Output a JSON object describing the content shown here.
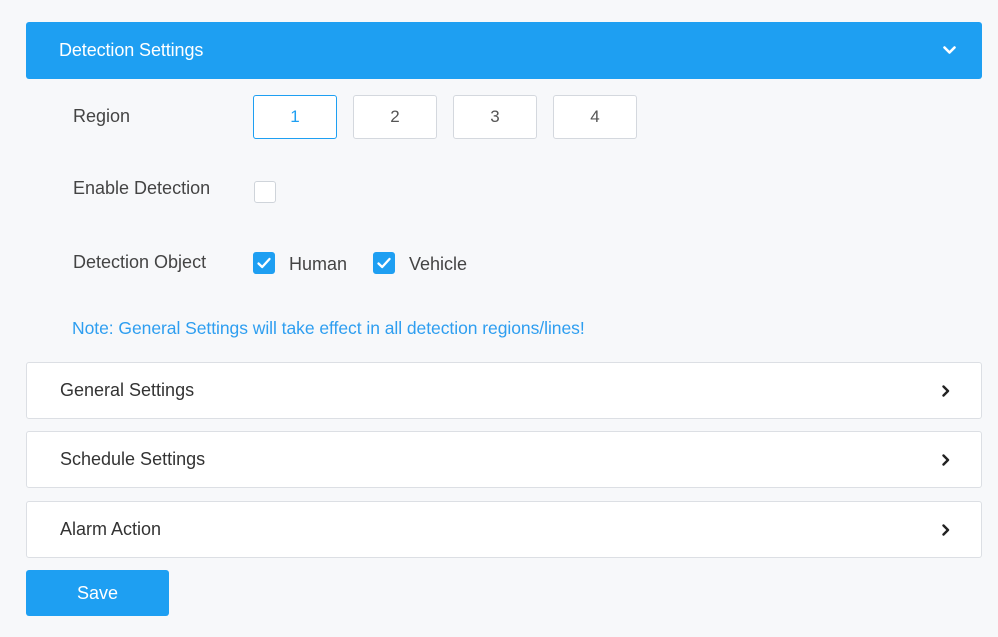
{
  "detection_settings": {
    "title": "Detection Settings",
    "expanded": true,
    "region": {
      "label": "Region",
      "options": [
        "1",
        "2",
        "3",
        "4"
      ],
      "selected": "1"
    },
    "enable_detection": {
      "label": "Enable Detection",
      "checked": false
    },
    "detection_object": {
      "label": "Detection Object",
      "options": [
        {
          "label": "Human",
          "checked": true
        },
        {
          "label": "Vehicle",
          "checked": true
        }
      ]
    },
    "note": "Note: General Settings will take effect in all detection regions/lines!"
  },
  "sections": [
    {
      "title": "General Settings"
    },
    {
      "title": "Schedule Settings"
    },
    {
      "title": "Alarm Action"
    }
  ],
  "save_label": "Save",
  "colors": {
    "accent": "#1e9ff2",
    "note": "#2e9ef0",
    "border": "#dcdfe4"
  },
  "icons": {
    "expand": "chevron-down-icon",
    "collapsed": "chevron-right-icon",
    "check": "checkmark-icon"
  }
}
